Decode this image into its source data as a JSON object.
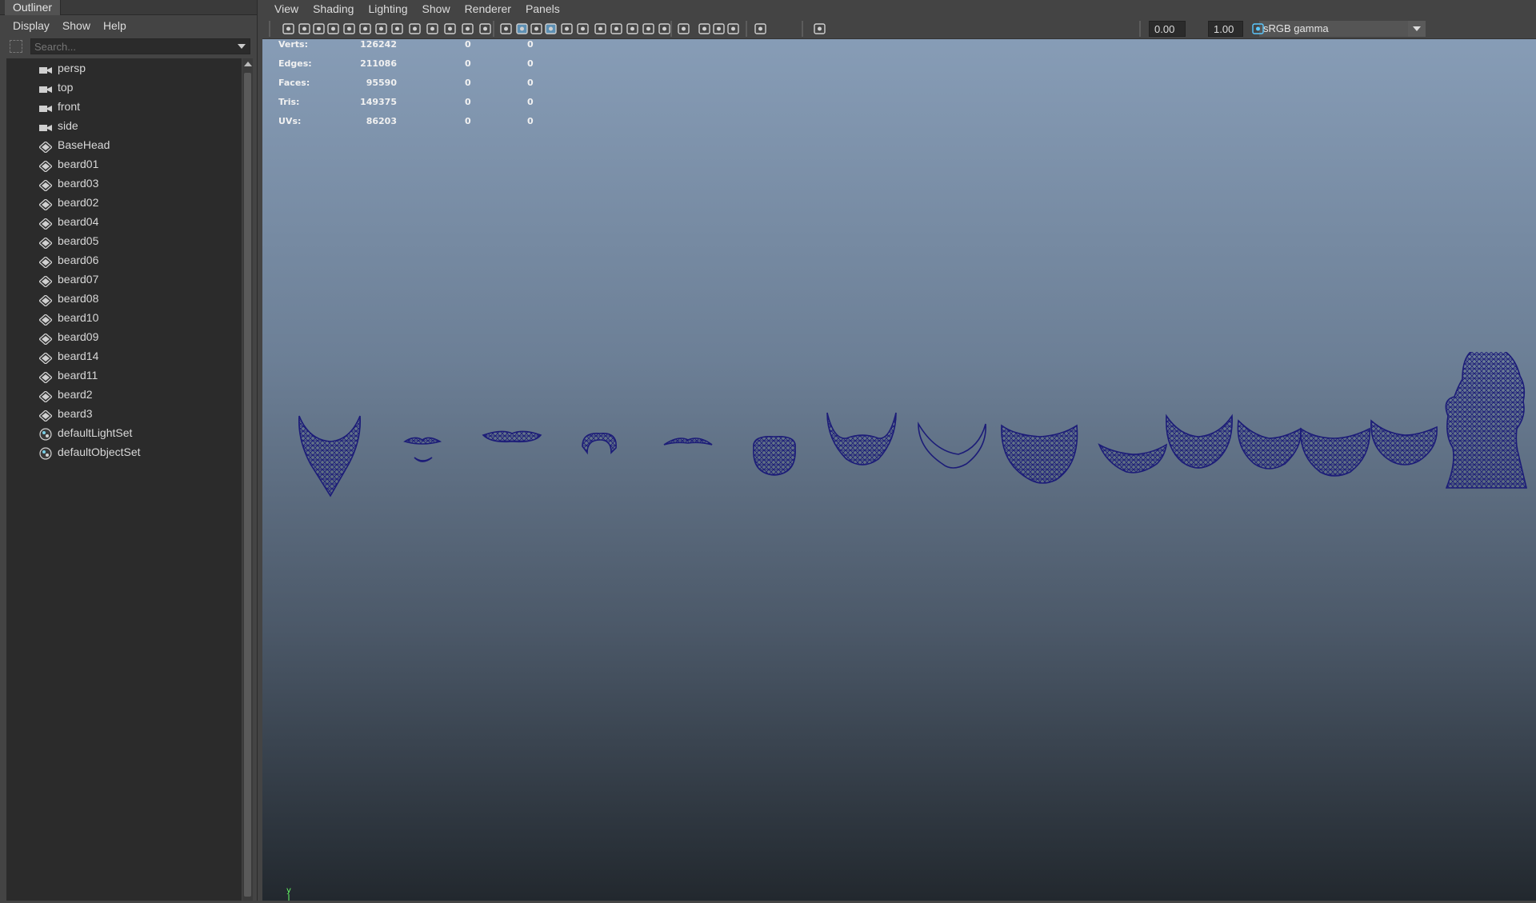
{
  "outliner": {
    "tab_label": "Outliner",
    "menu": [
      "Display",
      "Show",
      "Help"
    ],
    "search_placeholder": "Search...",
    "items": [
      {
        "label": "persp",
        "icon": "camera-icon"
      },
      {
        "label": "top",
        "icon": "camera-icon"
      },
      {
        "label": "front",
        "icon": "camera-icon"
      },
      {
        "label": "side",
        "icon": "camera-icon"
      },
      {
        "label": "BaseHead",
        "icon": "transform-icon"
      },
      {
        "label": "beard01",
        "icon": "transform-icon"
      },
      {
        "label": "beard03",
        "icon": "transform-icon"
      },
      {
        "label": "beard02",
        "icon": "transform-icon"
      },
      {
        "label": "beard04",
        "icon": "transform-icon"
      },
      {
        "label": "beard05",
        "icon": "transform-icon"
      },
      {
        "label": "beard06",
        "icon": "transform-icon"
      },
      {
        "label": "beard07",
        "icon": "transform-icon"
      },
      {
        "label": "beard08",
        "icon": "transform-icon"
      },
      {
        "label": "beard10",
        "icon": "transform-icon"
      },
      {
        "label": "beard09",
        "icon": "transform-icon"
      },
      {
        "label": "beard14",
        "icon": "transform-icon"
      },
      {
        "label": "beard11",
        "icon": "transform-icon"
      },
      {
        "label": "beard2",
        "icon": "transform-icon"
      },
      {
        "label": "beard3",
        "icon": "transform-icon"
      },
      {
        "label": "defaultLightSet",
        "icon": "set-icon"
      },
      {
        "label": "defaultObjectSet",
        "icon": "set-icon"
      }
    ]
  },
  "viewport": {
    "menu": [
      "View",
      "Shading",
      "Lighting",
      "Show",
      "Renderer",
      "Panels"
    ],
    "exposure_value": "0.00",
    "gamma_value": "1.00",
    "color_space": "sRGB gamma",
    "hud": [
      {
        "label": "Verts:",
        "value": "126242",
        "sel": "0",
        "comp": "0"
      },
      {
        "label": "Edges:",
        "value": "211086",
        "sel": "0",
        "comp": "0"
      },
      {
        "label": "Faces:",
        "value": "95590",
        "sel": "0",
        "comp": "0"
      },
      {
        "label": "Tris:",
        "value": "149375",
        "sel": "0",
        "comp": "0"
      },
      {
        "label": "UVs:",
        "value": "86203",
        "sel": "0",
        "comp": "0"
      }
    ],
    "axis_label": "y"
  },
  "colors": {
    "wireframe": "#1c1c78",
    "accent": "#5ac8ff"
  }
}
